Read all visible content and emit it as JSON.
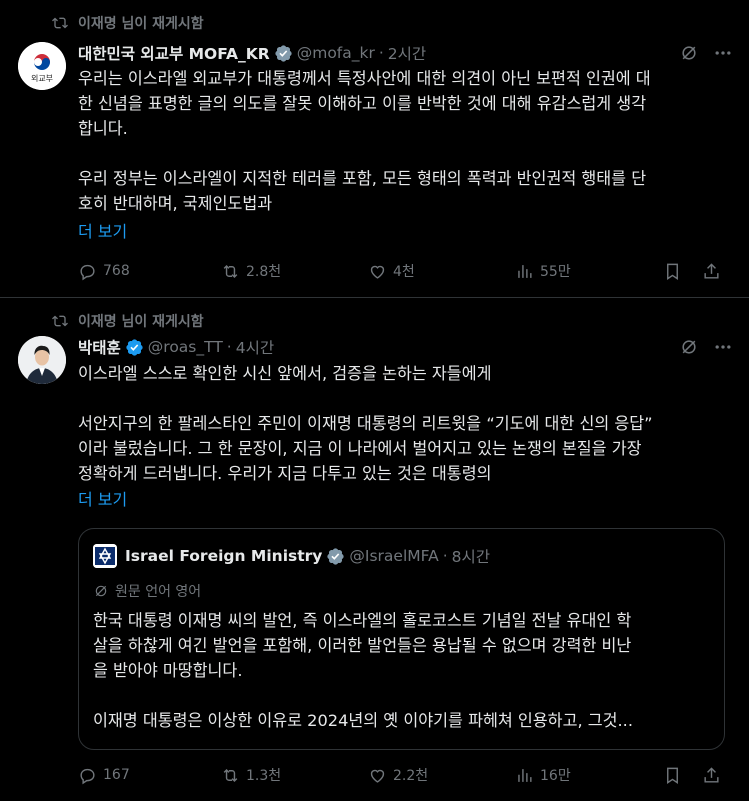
{
  "tweet1": {
    "repost_label": "이재명 님이 재게시함",
    "name": "대한민국 외교부 MOFA_KR",
    "handle": "@mofa_kr",
    "time": "2시간",
    "avatar_text": "외교부",
    "body": "우리는 이스라엘 외교부가 대통령께서 특정사안에 대한 의견이 아닌 보편적 인권에 대\n한 신념을 표명한 글의 의도를 잘못 이해하고 이를 반박한 것에 대해 유감스럽게 생각\n합니다.\n\n우리 정부는 이스라엘이 지적한 테러를 포함, 모든 형태의 폭력과 반인권적 행태를 단\n호히 반대하며, 국제인도법과",
    "more": "더 보기",
    "replies": "768",
    "reposts": "2.8천",
    "likes": "4천",
    "views": "55만"
  },
  "tweet2": {
    "repost_label": "이재명 님이 재게시함",
    "name": "박태훈",
    "handle": "@roas_TT",
    "time": "4시간",
    "body": "이스라엘 스스로 확인한 시신 앞에서, 검증을 논하는 자들에게\n\n서안지구의 한 팔레스타인 주민이 이재명 대통령의 리트윗을 “기도에 대한 신의 응답”\n이라 불렀습니다. 그 한 문장이, 지금 이 나라에서 벌어지고 있는 논쟁의 본질을 가장\n정확하게 드러냅니다. 우리가 지금 다투고 있는 것은 대통령의",
    "more": "더 보기",
    "replies": "167",
    "reposts": "1.3천",
    "likes": "2.2천",
    "views": "16만",
    "quote": {
      "name": "Israel Foreign Ministry",
      "handle": "@IsraelMFA",
      "time": "8시간",
      "translation_label": "원문 언어 영어",
      "body": "한국 대통령 이재명 씨의 발언, 즉 이스라엘의 홀로코스트 기념일 전날 유대인 학\n살을 하찮게 여긴 발언을 포함해, 이러한 발언들은 용납될 수 없으며 강력한 비난\n을 받아야 마땅합니다.\n\n이재명 대통령은 이상한 이유로 2024년의 옛 이야기를 파헤쳐 인용하고, 그것..."
    }
  },
  "colors": {
    "background": "#000000",
    "text": "#e7e9ea",
    "secondary": "#71767b",
    "link": "#1d9bf0",
    "verified_gold": "#e2b719",
    "verified_blue": "#1d9bf0",
    "verified_gray": "#829aab",
    "border": "#2f3336"
  }
}
